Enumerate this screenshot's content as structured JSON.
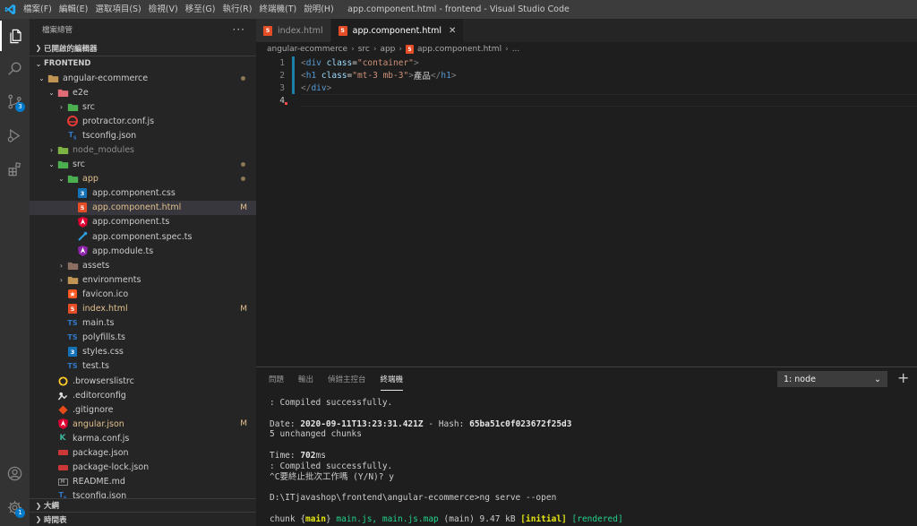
{
  "titlebar": {
    "menu": [
      "檔案(F)",
      "編輯(E)",
      "選取項目(S)",
      "檢視(V)",
      "移至(G)",
      "執行(R)",
      "終端機(T)",
      "說明(H)"
    ],
    "title": "app.component.html - frontend - Visual Studio Code"
  },
  "activity": {
    "items": [
      "explorer-icon",
      "search-icon",
      "source-control-icon",
      "run-debug-icon",
      "extensions-icon",
      "account-icon",
      "settings-icon"
    ],
    "scm_badge": "3",
    "settings_badge": "1"
  },
  "sidebar": {
    "title": "檔案總管",
    "more": "···",
    "open_editors": "已開啟的編輯器",
    "root": "FRONTEND",
    "outline": "大綱",
    "timeline": "時間表",
    "tree": [
      {
        "label": "angular-ecommerce",
        "depth": 1,
        "twisty": "open",
        "icon": "folder",
        "dot": true
      },
      {
        "label": "e2e",
        "depth": 2,
        "twisty": "open",
        "icon": "folder-e2e"
      },
      {
        "label": "src",
        "depth": 3,
        "twisty": "closed",
        "icon": "folder-src"
      },
      {
        "label": "protractor.conf.js",
        "depth": 3,
        "icon": "protractor"
      },
      {
        "label": "tsconfig.json",
        "depth": 3,
        "icon": "tsconfig"
      },
      {
        "label": "node_modules",
        "depth": 2,
        "twisty": "closed",
        "icon": "folder-node",
        "dim": true
      },
      {
        "label": "src",
        "depth": 2,
        "twisty": "open",
        "icon": "folder-src",
        "dot": true
      },
      {
        "label": "app",
        "depth": 3,
        "twisty": "open",
        "icon": "folder-app",
        "dot": true,
        "mod": true
      },
      {
        "label": "app.component.css",
        "depth": 4,
        "icon": "css"
      },
      {
        "label": "app.component.html",
        "depth": 4,
        "icon": "html",
        "status": "M",
        "mod": true,
        "selected": true
      },
      {
        "label": "app.component.ts",
        "depth": 4,
        "icon": "angular"
      },
      {
        "label": "app.component.spec.ts",
        "depth": 4,
        "icon": "spec"
      },
      {
        "label": "app.module.ts",
        "depth": 4,
        "icon": "angular-module"
      },
      {
        "label": "assets",
        "depth": 3,
        "twisty": "closed",
        "icon": "folder-assets"
      },
      {
        "label": "environments",
        "depth": 3,
        "twisty": "closed",
        "icon": "folder"
      },
      {
        "label": "favicon.ico",
        "depth": 3,
        "icon": "favicon"
      },
      {
        "label": "index.html",
        "depth": 3,
        "icon": "html",
        "status": "M",
        "mod": true
      },
      {
        "label": "main.ts",
        "depth": 3,
        "icon": "ts"
      },
      {
        "label": "polyfills.ts",
        "depth": 3,
        "icon": "ts"
      },
      {
        "label": "styles.css",
        "depth": 3,
        "icon": "css"
      },
      {
        "label": "test.ts",
        "depth": 3,
        "icon": "ts"
      },
      {
        "label": ".browserslistrc",
        "depth": 2,
        "icon": "browserslist"
      },
      {
        "label": ".editorconfig",
        "depth": 2,
        "icon": "editorconfig"
      },
      {
        "label": ".gitignore",
        "depth": 2,
        "icon": "git"
      },
      {
        "label": "angular.json",
        "depth": 2,
        "icon": "angular",
        "status": "M",
        "mod": true
      },
      {
        "label": "karma.conf.js",
        "depth": 2,
        "icon": "karma"
      },
      {
        "label": "package.json",
        "depth": 2,
        "icon": "npm"
      },
      {
        "label": "package-lock.json",
        "depth": 2,
        "icon": "npm"
      },
      {
        "label": "README.md",
        "depth": 2,
        "icon": "markdown"
      },
      {
        "label": "tsconfig.json",
        "depth": 2,
        "icon": "tsconfig"
      }
    ]
  },
  "editor": {
    "tabs": [
      {
        "label": "index.html",
        "active": false
      },
      {
        "label": "app.component.html",
        "active": true,
        "close": "✕"
      }
    ],
    "breadcrumb": [
      "angular-ecommerce",
      "src",
      "app",
      "app.component.html",
      "..."
    ],
    "lines": [
      {
        "n": "1",
        "parts": [
          [
            "tagc",
            "<"
          ],
          [
            "tagn",
            "div"
          ],
          [
            "txt",
            " "
          ],
          [
            "attr",
            "class"
          ],
          [
            "txt",
            "="
          ],
          [
            "str",
            "\"container\""
          ],
          [
            "tagc",
            ">"
          ]
        ]
      },
      {
        "n": "2",
        "parts": [
          [
            "tagc",
            "<"
          ],
          [
            "tagn",
            "h1"
          ],
          [
            "txt",
            " "
          ],
          [
            "attr",
            "class"
          ],
          [
            "txt",
            "="
          ],
          [
            "str",
            "\"mt-3 mb-3\""
          ],
          [
            "tagc",
            ">"
          ],
          [
            "txt",
            "產品"
          ],
          [
            "tagc",
            "</"
          ],
          [
            "tagn",
            "h1"
          ],
          [
            "tagc",
            ">"
          ]
        ]
      },
      {
        "n": "3",
        "parts": [
          [
            "tagc",
            "</"
          ],
          [
            "tagn",
            "div"
          ],
          [
            "tagc",
            ">"
          ]
        ]
      },
      {
        "n": "4",
        "parts": []
      }
    ]
  },
  "panel": {
    "tabs": [
      "問題",
      "輸出",
      "偵錯主控台",
      "終端機"
    ],
    "active_tab": "終端機",
    "terminal_select": "1: node",
    "terminal_select_arrow": "⌄",
    "new_terminal": "+",
    "lines": [
      [
        [
          "",
          ": Compiled successfully."
        ]
      ],
      [
        [
          "",
          ""
        ]
      ],
      [
        [
          "",
          "Date: "
        ],
        [
          "b",
          "2020-09-11T13:23:31.421Z"
        ],
        [
          "",
          " - Hash: "
        ],
        [
          "b",
          "65ba51c0f023672f25d3"
        ]
      ],
      [
        [
          "",
          "5 unchanged chunks"
        ]
      ],
      [
        [
          "",
          ""
        ]
      ],
      [
        [
          "",
          "Time: "
        ],
        [
          "b",
          "702"
        ],
        [
          "",
          "ms"
        ]
      ],
      [
        [
          "",
          ": Compiled successfully."
        ]
      ],
      [
        [
          "",
          "^C要終止批次工作嗎 (Y/N)? y"
        ]
      ],
      [
        [
          "",
          ""
        ]
      ],
      [
        [
          "",
          "D:\\ITjavashop\\frontend\\angular-ecommerce>ng serve --open"
        ]
      ],
      [
        [
          "",
          ""
        ]
      ],
      [
        [
          "",
          "chunk {"
        ],
        [
          "y",
          "main"
        ],
        [
          "",
          "} "
        ],
        [
          "g",
          "main.js, main.js.map"
        ],
        [
          "",
          " (main) 9.47 kB "
        ],
        [
          "y",
          "[initial]"
        ],
        [
          "",
          " "
        ],
        [
          "g",
          "[rendered]"
        ]
      ]
    ]
  },
  "colors": {
    "accent": "#007acc",
    "modified": "#e2c08d",
    "html_icon": "#e44d26",
    "selection": "#37373d"
  }
}
